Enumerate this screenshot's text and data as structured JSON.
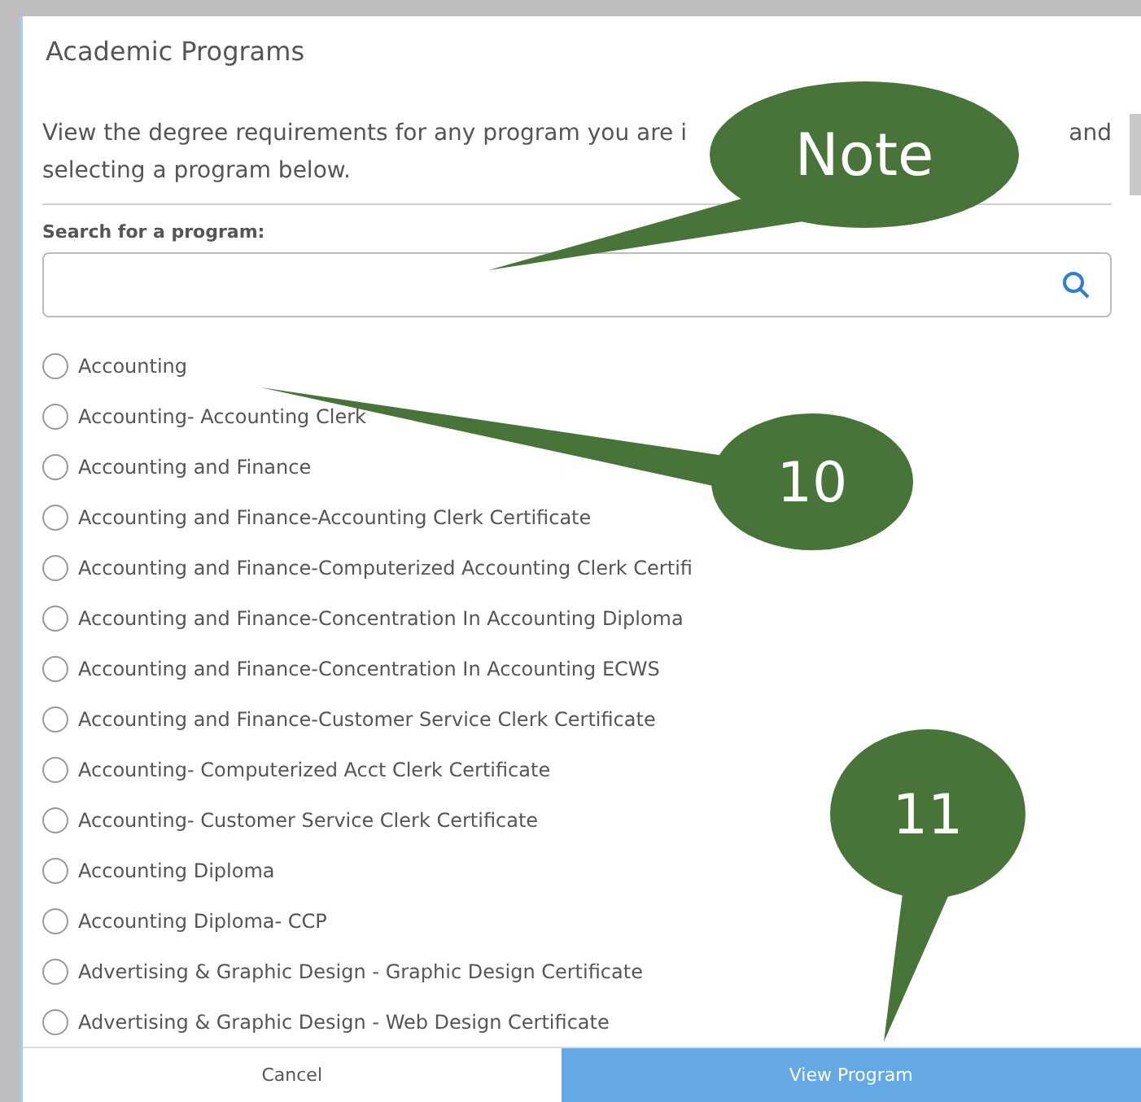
{
  "dialog": {
    "title": "Academic Programs",
    "description": [
      "View the degree requirements for any program you are i",
      "and",
      "selecting a program below."
    ],
    "search": {
      "label": "Search for a program:"
    },
    "programs": [
      {
        "label": "Accounting",
        "selected": false
      },
      {
        "label": "Accounting- Accounting Clerk",
        "selected": false
      },
      {
        "label": "Accounting and Finance",
        "selected": false
      },
      {
        "label": "Accounting and Finance-Accounting Clerk Certificate",
        "selected": false
      },
      {
        "label": "Accounting and Finance-Computerized Accounting Clerk Certifi",
        "selected": false
      },
      {
        "label": "Accounting and Finance-Concentration In Accounting Diploma",
        "selected": false
      },
      {
        "label": "Accounting and Finance-Concentration In Accounting ECWS",
        "selected": false
      },
      {
        "label": "Accounting and Finance-Customer Service Clerk Certificate",
        "selected": false
      },
      {
        "label": "Accounting- Computerized Acct Clerk Certificate",
        "selected": false
      },
      {
        "label": "Accounting- Customer Service Clerk Certificate",
        "selected": false
      },
      {
        "label": "Accounting Diploma",
        "selected": false
      },
      {
        "label": "Accounting Diploma- CCP",
        "selected": false
      },
      {
        "label": "Advertising & Graphic Design - Graphic Design Certificate",
        "selected": false
      },
      {
        "label": "Advertising & Graphic Design - Web Design Certificate",
        "selected": false
      }
    ],
    "buttons": [
      {
        "label": "Cancel",
        "kind": "secondary"
      },
      {
        "label": "View Program",
        "kind": "primary"
      }
    ]
  },
  "callouts": [
    {
      "label": "Note"
    },
    {
      "label": "10"
    },
    {
      "label": "11"
    }
  ]
}
